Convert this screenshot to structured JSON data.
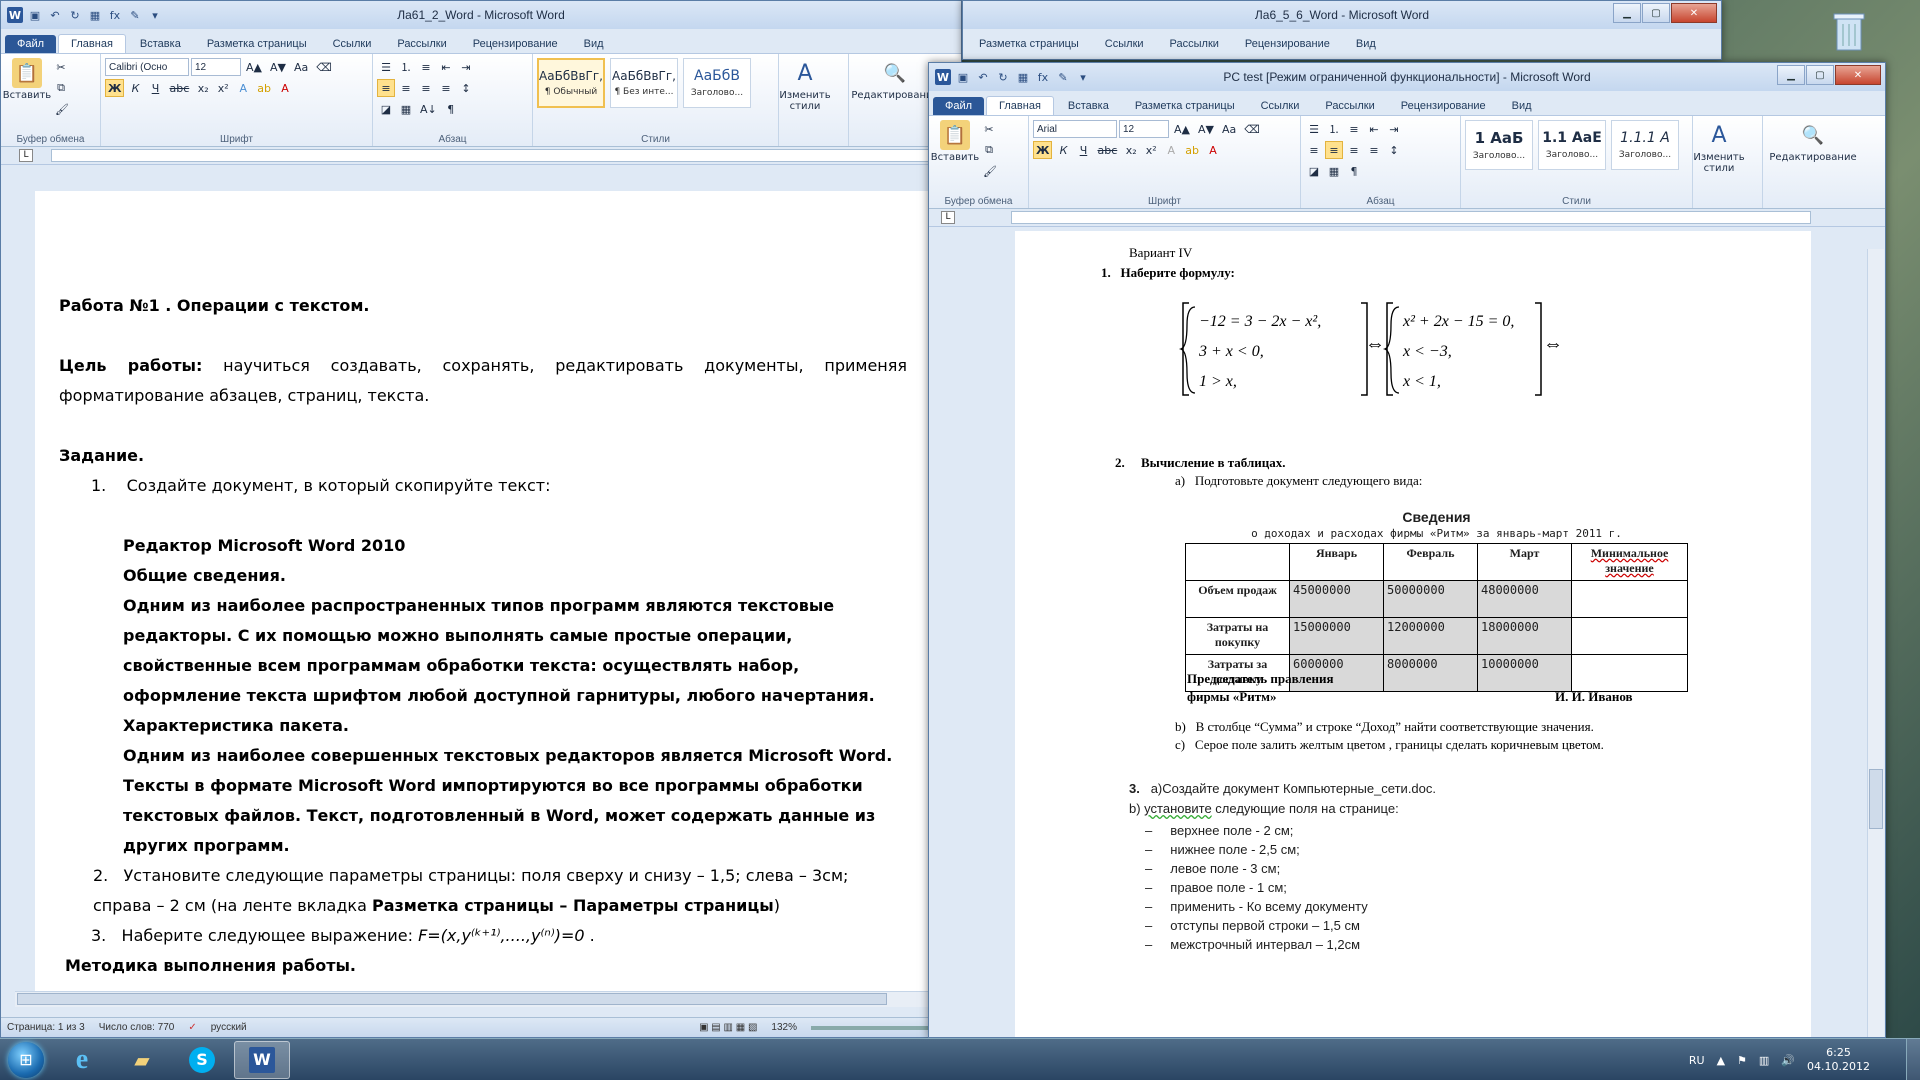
{
  "desktop": {
    "recycle_icon": "recycle-bin-icon"
  },
  "left_window": {
    "title": "Ла61_2_Word - Microsoft Word",
    "tabs": [
      "Файл",
      "Главная",
      "Вставка",
      "Разметка страницы",
      "Ссылки",
      "Рассылки",
      "Рецензирование",
      "Вид"
    ],
    "ribbon": {
      "paste_label": "Вставить",
      "font_name": "Calibri (Осно",
      "font_size": "12",
      "groups": {
        "clipboard": "Буфер обмена",
        "font": "Шрифт",
        "paragraph": "Абзац",
        "styles": "Стили"
      },
      "styles": [
        {
          "sample": "АаБбВвГг,",
          "name": "¶ Обычный"
        },
        {
          "sample": "АаБбВвГг,",
          "name": "¶ Без инте..."
        },
        {
          "sample": "АаБбВ",
          "name": "Заголово..."
        }
      ],
      "change_styles": "Изменить стили",
      "editing": "Редактирование"
    },
    "doc": {
      "title": "Работа №1 . Операции с текстом.",
      "goal_label": "Цель работы:",
      "goal_text": " научиться создавать, сохранять, редактировать документы, применяя форматирование абзацев, страниц, текста.",
      "task_label": "Задание.",
      "item1": "Создайте документ, в который скопируйте текст:",
      "editor_title": "Редактор Microsoft Word 2010",
      "general": "Общие сведения.",
      "para1": "Одним из наиболее распространенных типов программ являются текстовые редакторы. С их помощью можно выполнять самые простые операции, свойственные всем программам обработки текста: осуществлять набор, оформление текста шрифтом любой доступной гарнитуры, любого начертания.",
      "char": "Характеристика пакета.",
      "para2": "Одним из наиболее совершенных текстовых редакторов является Microsoft Word. Тексты в формате Microsoft Word импортируются во все программы обработки текстовых файлов. Текст, подготовленный в Word, может содержать данные из других программ.",
      "item2_a": "Установите следующие параметры страницы: поля сверху и снизу – 1,5; слева – 3см; справа – 2 см (на ленте вкладка ",
      "item2_b": "Разметка страницы – Параметры страницы",
      "item2_c": ")",
      "item3_a": "Наберите следующее выражение: ",
      "item3_formula": "F=(x,y⁽ᵏ⁺¹⁾,....,y⁽ⁿ⁾)=0",
      "item3_b": " .",
      "method": "Методика выполнения работы."
    },
    "status": {
      "page": "Страница: 1 из 3",
      "words": "Число слов: 770",
      "lang": "русский",
      "zoom": "132%"
    }
  },
  "middle_window": {
    "title": "Ла6_5_6_Word - Microsoft Word",
    "tabs": [
      "Разметка страницы",
      "Ссылки",
      "Рассылки",
      "Рецензирование",
      "Вид"
    ]
  },
  "right_window": {
    "title": "PC test [Режим ограниченной функциональности] - Microsoft Word",
    "tabs": [
      "Файл",
      "Главная",
      "Вставка",
      "Разметка страницы",
      "Ссылки",
      "Рассылки",
      "Рецензирование",
      "Вид"
    ],
    "ribbon": {
      "paste_label": "Вставить",
      "font_name": "Arial",
      "font_size": "12",
      "groups": {
        "clipboard": "Буфер обмена",
        "font": "Шрифт",
        "paragraph": "Абзац",
        "styles": "Стили"
      },
      "styles": [
        {
          "sample": "1 АаБ",
          "name": "Заголово..."
        },
        {
          "sample": "1.1 АаЕ",
          "name": "Заголово..."
        },
        {
          "sample": "1.1.1 А",
          "name": "Заголово..."
        }
      ],
      "change_styles": "Изменить стили",
      "editing": "Редактирование"
    },
    "doc": {
      "variant": "Вариант IV",
      "q1": "Наберите формулу:",
      "sys1": [
        "−12 = 3 − 2x − x²,",
        "3 + x < 0,",
        "1 > x,"
      ],
      "sys2": [
        "x² + 2x − 15 = 0,",
        "x < −3,",
        "x < 1,"
      ],
      "equiv": "⇔",
      "q2": "Вычисление в таблицах",
      "q2a": "Подготовьте документ следующего вида:",
      "sved_title": "Сведения",
      "sved_sub": "о доходах и расходах фирмы «Ритм» за январь-март 2011 г.",
      "table_head": [
        "",
        "Январь",
        "Февраль",
        "Март",
        "Минимальное значение"
      ],
      "table_rows": [
        [
          "Объем продаж",
          "45000000",
          "50000000",
          "48000000",
          ""
        ],
        [
          "Затраты на покупку",
          "15000000",
          "12000000",
          "18000000",
          ""
        ],
        [
          "Затраты за доставку",
          "6000000",
          "8000000",
          "10000000",
          ""
        ]
      ],
      "chair1": "Председатель правления",
      "chair2": "фирмы «Ритм»",
      "chair_name": "И. И. Иванов",
      "q2b": "В столбце “Сумма” и строке “Доход” найти соответствующие значения.",
      "q2c": "Серое поле залить желтым цветом , границы сделать коричневым цветом.",
      "q3a": "а)Создайте документ Компьютерные_сети.doc.",
      "q3b_u": "установите",
      "q3b": " следующие поля на странице:",
      "margins": [
        "верхнее поле - 2 см;",
        "нижнее поле - 2,5 см;",
        "левое поле - 3 см;",
        "правое поле - 1 см;",
        "применить - Ко всему документу",
        "отступы первой строки – 1,5 см",
        "межстрочный интервал – 1,2см"
      ]
    }
  },
  "taskbar": {
    "lang": "RU",
    "time": "6:25",
    "date": "04.10.2012"
  }
}
